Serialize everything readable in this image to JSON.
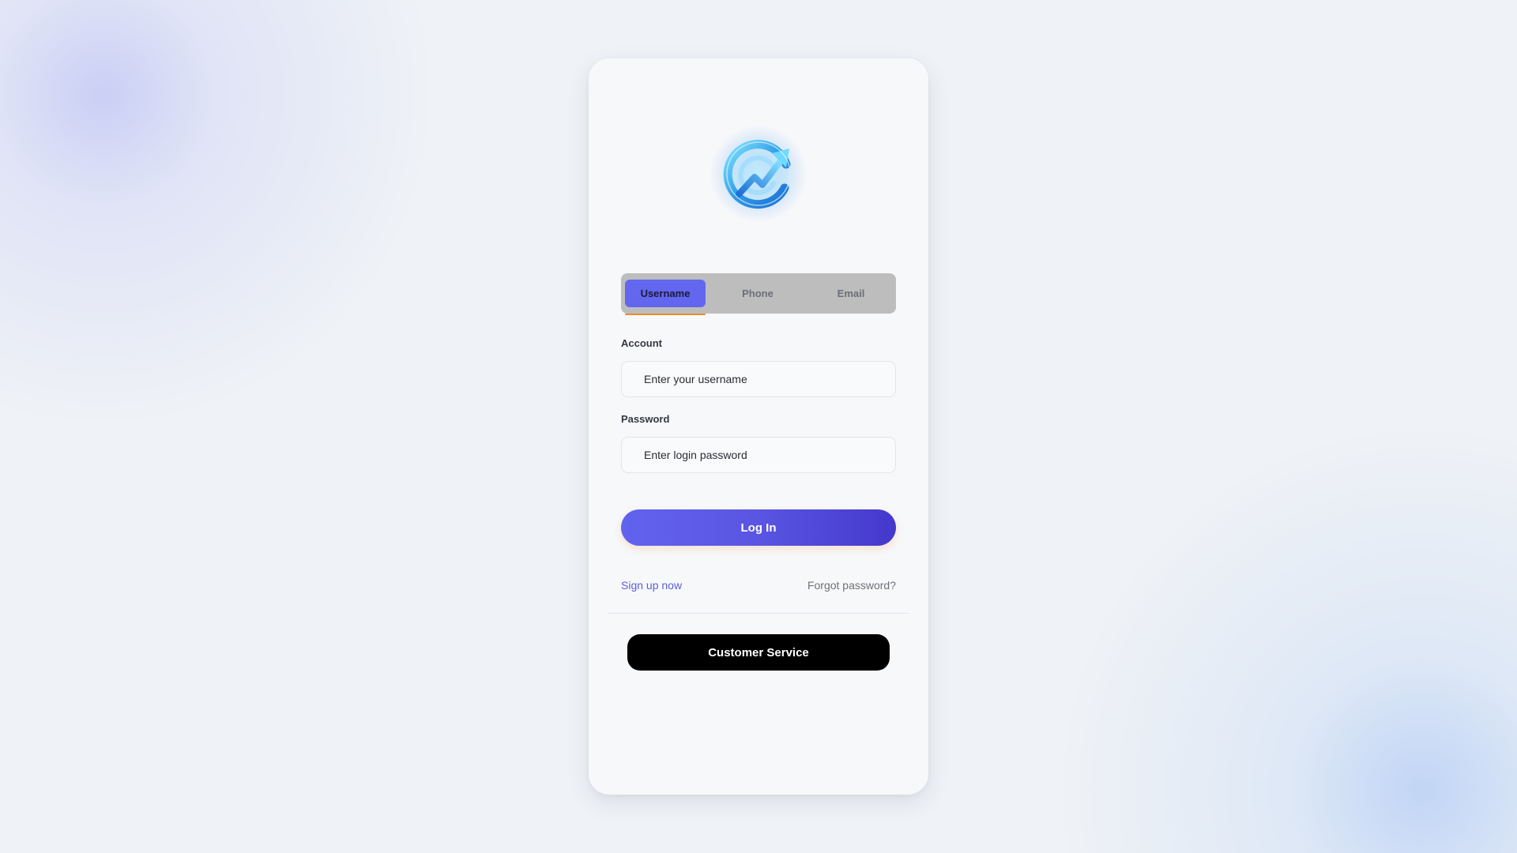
{
  "tabs": [
    {
      "label": "Username",
      "active": true
    },
    {
      "label": "Phone",
      "active": false
    },
    {
      "label": "Email",
      "active": false
    }
  ],
  "form": {
    "account_label": "Account",
    "account_placeholder": "Enter your username",
    "password_label": "Password",
    "password_placeholder": "Enter login password",
    "login_label": "Log In"
  },
  "links": {
    "signup": "Sign up now",
    "forgot": "Forgot password?"
  },
  "customer_service_label": "Customer Service",
  "colors": {
    "accent": "#6366ee",
    "tab_underline": "#f08a2c",
    "signup_link": "#5b5fd6",
    "cs_button": "#000000"
  },
  "icons": {
    "logo": "refresh-arrow-logo-icon"
  }
}
